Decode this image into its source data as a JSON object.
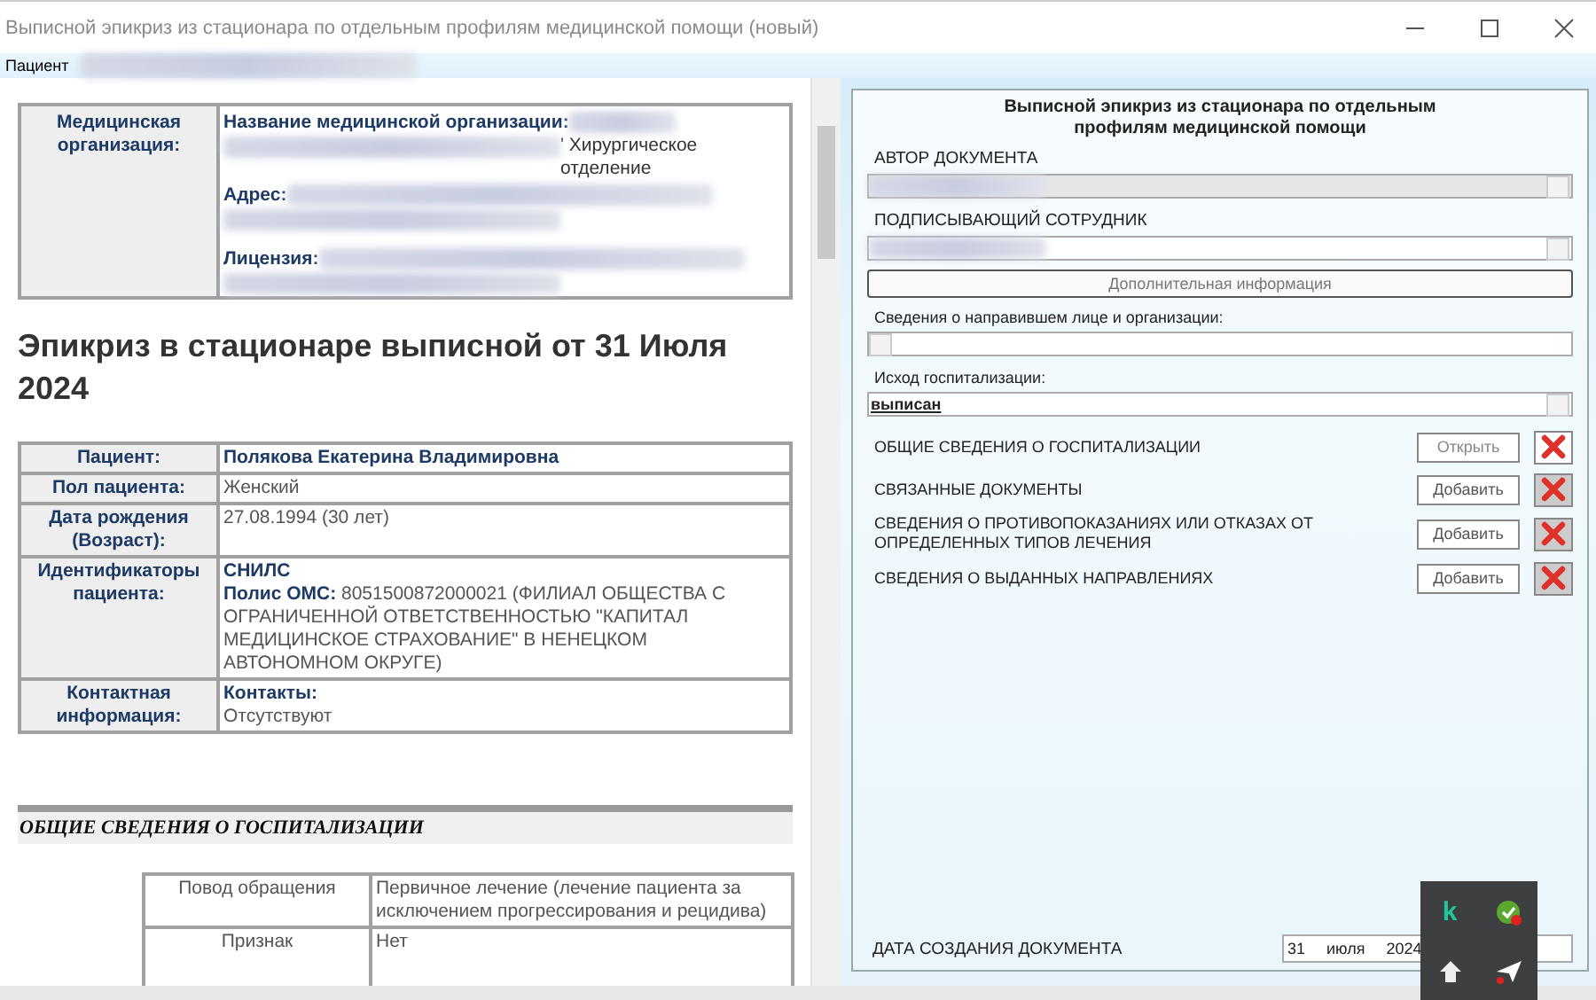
{
  "window": {
    "title": "Выписной эпикриз из стационара по отдельным профилям медицинской помощи (новый)"
  },
  "menu": [
    {
      "label": "Пациент"
    }
  ],
  "document": {
    "org": {
      "label": "Медицинская организация:",
      "fields": [
        {
          "label": "Название медицинской организации:",
          "value": "' Хирургическое отделение"
        },
        {
          "label": "Адрес:"
        },
        {
          "label": "Лицензия:"
        }
      ]
    },
    "heading": "Эпикриз в стационаре выписной от 31 Июля 2024",
    "patient_rows": [
      {
        "label": "Пациент:",
        "lines": [
          "Полякова Екатерина Владимировна"
        ],
        "kind": "name"
      },
      {
        "label": "Пол пациента:",
        "lines": [
          "Женский"
        ],
        "kind": "text"
      },
      {
        "label": "Дата рождения (Возраст):",
        "lines": [
          "27.08.1994 (30 лет)"
        ],
        "kind": "text"
      },
      {
        "label": "Идентификаторы пациента:",
        "lines": [
          "**СНИЛС**",
          "**Полис ОМС:** 8051500872000021 (ФИЛИАЛ ОБЩЕСТВА С ОГРАНИЧЕННОЙ ОТВЕТСТВЕННОСТЬЮ \"КАПИТАЛ МЕДИЦИНСКОЕ СТРАХОВАНИЕ\" В НЕНЕЦКОМ АВТОНОМНОМ ОКРУГЕ)"
        ],
        "kind": "text"
      },
      {
        "label": "Контактная информация:",
        "lines": [
          "**Контакты:**",
          "Отсутствуют"
        ],
        "kind": "contact"
      }
    ],
    "section": "ОБЩИЕ СВЕДЕНИЯ О ГОСПИТАЛИЗАЦИИ",
    "hosp_rows": [
      {
        "label": "Повод обращения",
        "value": "Первичное лечение (лечение пациента за исключением прогрессирования и рецидива)"
      },
      {
        "label": "Признак",
        "value": "Нет"
      }
    ]
  },
  "form": {
    "title": "Выписной эпикриз из стационара по отдельным профилям медицинской помощи",
    "author": {
      "label": "АВТОР ДОКУМЕНТА",
      "disabled": true
    },
    "signer": {
      "label": "ПОДПИСЫВАЮЩИЙ СОТРУДНИК",
      "disabled": false
    },
    "extra_button": "Дополнительная информация",
    "referral": {
      "label": "Сведения о направившем лице и организации:"
    },
    "outcome": {
      "label": "Исход госпитализации:",
      "value": "выписан"
    },
    "sections": [
      {
        "label": "ОБЩИЕ СВЕДЕНИЯ О ГОСПИТАЛИЗАЦИИ",
        "button": "Открыть",
        "filled": true
      },
      {
        "label": "СВЯЗАННЫЕ ДОКУМЕНТЫ",
        "button": "Добавить",
        "filled": false
      },
      {
        "label": "СВЕДЕНИЯ О ПРОТИВОПОКАЗАНИЯХ ИЛИ ОТКАЗАХ ОТ ОПРЕДЕЛЕННЫХ ТИПОВ ЛЕЧЕНИЯ",
        "button": "Добавить",
        "filled": false
      },
      {
        "label": "СВЕДЕНИЯ О ВЫДАННЫХ НАПРАВЛЕНИЯХ",
        "button": "Добавить",
        "filled": false
      }
    ],
    "date": {
      "label": "ДАТА СОЗДАНИЯ ДОКУМЕНТА",
      "day": "31",
      "month": "июля",
      "year": "2024"
    }
  },
  "tray": {
    "logo": "k"
  }
}
